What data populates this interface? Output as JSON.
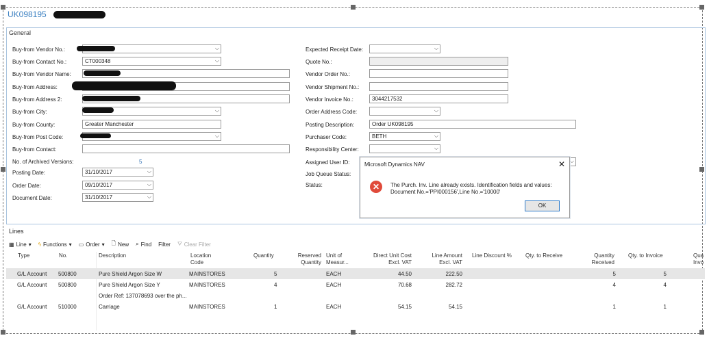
{
  "header": {
    "title": "UK098195"
  },
  "general": {
    "title": "General",
    "left": {
      "vendor_no_label": "Buy-from Vendor No.:",
      "contact_no_label": "Buy-from Contact No.:",
      "contact_no_value": "CT000348",
      "vendor_name_label": "Buy-from Vendor Name:",
      "address_label": "Buy-from Address:",
      "address2_label": "Buy-from Address 2:",
      "city_label": "Buy-from City:",
      "county_label": "Buy-from County:",
      "county_value": "Greater Manchester",
      "post_code_label": "Buy-from Post Code:",
      "contact_label": "Buy-from Contact:",
      "archived_label": "No. of Archived Versions:",
      "archived_value": "5",
      "posting_date_label": "Posting Date:",
      "posting_date_value": "31/10/2017",
      "order_date_label": "Order Date:",
      "order_date_value": "09/10/2017",
      "document_date_label": "Document Date:",
      "document_date_value": "31/10/2017"
    },
    "right": {
      "expected_receipt_label": "Expected Receipt Date:",
      "quote_no_label": "Quote No.:",
      "vendor_order_label": "Vendor Order No.:",
      "vendor_shipment_label": "Vendor Shipment No.:",
      "vendor_invoice_label": "Vendor Invoice No.:",
      "vendor_invoice_value": "3044217532",
      "order_address_label": "Order Address Code:",
      "posting_desc_label": "Posting Description:",
      "posting_desc_value": "Order UK098195",
      "purchaser_label": "Purchaser Code:",
      "purchaser_value": "BETH",
      "responsibility_label": "Responsibility Center:",
      "assigned_user_label": "Assigned User ID:",
      "job_queue_label": "Job Queue Status:",
      "status_label": "Status:"
    }
  },
  "lines": {
    "title": "Lines",
    "toolbar": {
      "line": "Line",
      "functions": "Functions",
      "order": "Order",
      "new": "New",
      "find": "Find",
      "filter": "Filter",
      "clear_filter": "Clear Filter"
    },
    "columns": {
      "type": "Type",
      "no": "No.",
      "description": "Description",
      "location1": "Location",
      "location2": "Code",
      "quantity": "Quantity",
      "reserved1": "Reserved",
      "reserved2": "Quantity",
      "unit1": "Unit of",
      "unit2": "Measur...",
      "direct1": "Direct Unit Cost",
      "direct2": "Excl. VAT",
      "amount1": "Line Amount",
      "amount2": "Excl. VAT",
      "discount": "Line Discount %",
      "qty_receive": "Qty. to Receive",
      "qty_received1": "Quantity",
      "qty_received2": "Received",
      "qty_invoice": "Qty. to Invoice",
      "qua1": "Qua",
      "qua2": "Invo"
    },
    "rows": [
      {
        "type": "G/L Account",
        "no": "500800",
        "description": "Pure Shield Argon Size W",
        "location": "MAINSTORES",
        "quantity": "5",
        "unit": "EACH",
        "direct": "44.50",
        "amount": "222.50",
        "received": "5",
        "invoice": "5"
      },
      {
        "type": "G/L Account",
        "no": "500800",
        "description": "Pure Shield Argon Size Y",
        "location": "MAINSTORES",
        "quantity": "4",
        "unit": "EACH",
        "direct": "70.68",
        "amount": "282.72",
        "received": "4",
        "invoice": "4"
      },
      {
        "type": "",
        "no": "",
        "description": "Order Ref: 137078693 over the ph...",
        "location": "",
        "quantity": "",
        "unit": "",
        "direct": "",
        "amount": "",
        "received": "",
        "invoice": ""
      },
      {
        "type": "G/L Account",
        "no": "510000",
        "description": "Carriage",
        "location": "MAINSTORES",
        "quantity": "1",
        "unit": "EACH",
        "direct": "54.15",
        "amount": "54.15",
        "received": "1",
        "invoice": "1"
      }
    ]
  },
  "dialog": {
    "title": "Microsoft Dynamics NAV",
    "message_line1": "The Purch. Inv. Line already exists. Identification fields and values:",
    "message_line2": "Document No.='PPI000156',Line No.='10000'",
    "ok_label": "OK",
    "close_glyph": "✕"
  },
  "colors": {
    "accent": "#3a7fc1",
    "error": "#e04a3a",
    "selected_row": "#e6e6e6"
  }
}
